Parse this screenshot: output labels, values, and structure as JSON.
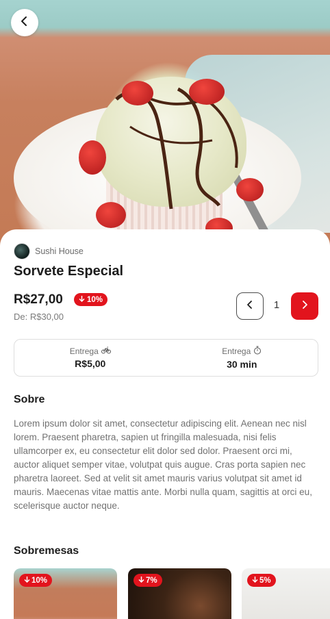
{
  "nav": {
    "back_icon": "chevron-left-icon"
  },
  "product": {
    "restaurant": "Sushi House",
    "name": "Sorvete Especial",
    "price": "R$27,00",
    "discount": "10%",
    "old_price": "De: R$30,00",
    "quantity": "1"
  },
  "delivery": {
    "fee_label": "Entrega",
    "fee_value": "R$5,00",
    "fee_icon": "bike-icon",
    "time_label": "Entrega",
    "time_value": "30 min",
    "time_icon": "stopwatch-icon"
  },
  "about": {
    "title": "Sobre",
    "text": "Lorem ipsum dolor sit amet, consectetur adipiscing elit. Aenean nec nisl lorem. Praesent pharetra, sapien ut fringilla malesuada, nisi felis ullamcorper ex, eu consectetur elit dolor sed dolor. Praesent orci mi, auctor aliquet semper vitae, volutpat quis augue. Cras porta sapien nec pharetra laoreet. Sed at velit sit amet mauris varius volutpat sit amet id mauris. Maecenas vitae mattis ante. Morbi nulla quam, sagittis at orci eu, scelerisque auctor neque."
  },
  "related": {
    "title": "Sobremesas",
    "items": [
      {
        "discount": "10%"
      },
      {
        "discount": "7%"
      },
      {
        "discount": "5%"
      }
    ]
  },
  "colors": {
    "accent": "#e2141d",
    "text": "#1d1d1d",
    "muted": "#717171"
  }
}
